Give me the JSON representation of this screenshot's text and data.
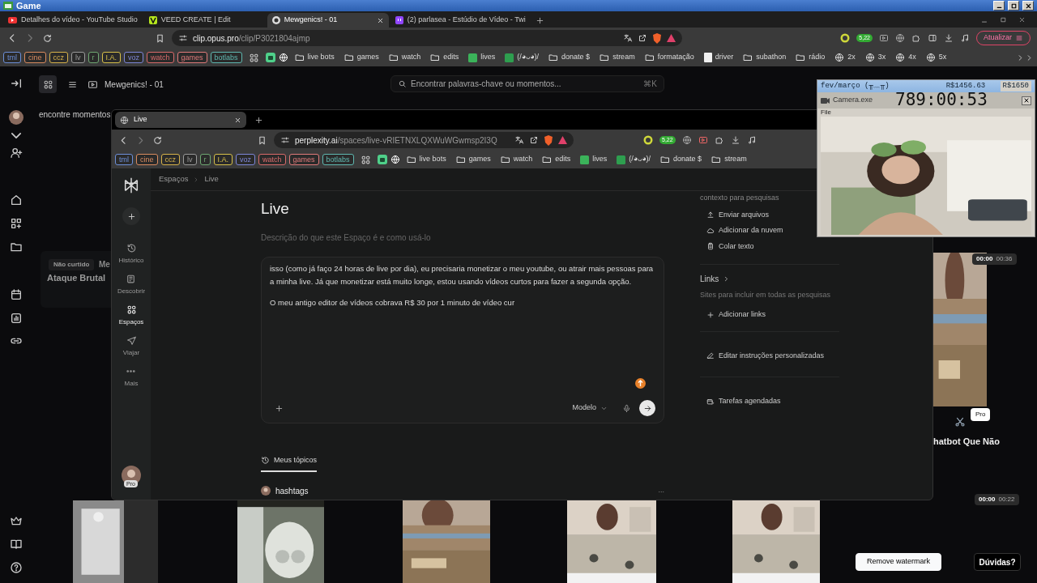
{
  "os_window": {
    "title": "Game"
  },
  "browser": {
    "tabs": [
      {
        "title": "Detalhes do vídeo - YouTube Studio",
        "selected": false
      },
      {
        "title": "VEED CREATE | Edit",
        "selected": false
      },
      {
        "title": "Mewgenics! - 01",
        "selected": true
      },
      {
        "title": "(2) parlasea - Estúdio de Vídeo - Twi",
        "selected": false
      }
    ],
    "address": {
      "domain": "clip.opus.pro",
      "path": "/clip/P3021804ajmp"
    },
    "extension_badge": "5,22",
    "update_button": "Atualizar",
    "bookmark_tags": [
      {
        "label": "tml",
        "color": "#6d8fd8"
      },
      {
        "label": "cine",
        "color": "#d98b5f"
      },
      {
        "label": "ccz",
        "color": "#d7b24a"
      },
      {
        "label": "lv",
        "color": "#9a9a9a"
      },
      {
        "label": "r",
        "color": "#6fa872"
      },
      {
        "label": "I.A.",
        "color": "#d7c04a"
      },
      {
        "label": "voz",
        "color": "#7d86d8"
      },
      {
        "label": "watch",
        "color": "#d86a6a"
      },
      {
        "label": "games",
        "color": "#e07a7a"
      },
      {
        "label": "botlabs",
        "color": "#5fb8b0"
      }
    ],
    "bookmarks": [
      {
        "label": "live bots",
        "kind": "folder"
      },
      {
        "label": "games",
        "kind": "folder"
      },
      {
        "label": "watch",
        "kind": "folder"
      },
      {
        "label": "edits",
        "kind": "folder"
      },
      {
        "label": "lives",
        "kind": "app"
      },
      {
        "label": "(/◕ᴗ◕)/",
        "kind": "app"
      },
      {
        "label": "donate $",
        "kind": "folder"
      },
      {
        "label": "stream",
        "kind": "folder"
      },
      {
        "label": "formatação",
        "kind": "folder"
      },
      {
        "label": "driver",
        "kind": "page"
      },
      {
        "label": "subathon",
        "kind": "folder"
      },
      {
        "label": "rádio",
        "kind": "folder"
      },
      {
        "label": "2x",
        "kind": "site"
      },
      {
        "label": "3x",
        "kind": "site"
      },
      {
        "label": "4x",
        "kind": "site"
      },
      {
        "label": "5x",
        "kind": "site"
      }
    ]
  },
  "editor": {
    "project_title": "Mewgenics! - 01",
    "search": {
      "placeholder": "Encontrar palavras-chave ou momentos...",
      "shortcut": "⌘K"
    },
    "hint": "encontre momentos",
    "clip_tag": "Não curtido",
    "clip_title_start": "Me",
    "clip_subtitle": "Ataque Brutal",
    "side_clip": {
      "time_current": "00:00",
      "time_total": "00:36",
      "badge": "Pro",
      "title": "hatbot Que Não"
    },
    "bottom_clip": {
      "time_current": "00:00",
      "time_total": "00:22"
    },
    "remove_watermark_button": "Remove watermark",
    "help_button": "Dúvidas?"
  },
  "inner_browser": {
    "tabs": [
      {
        "title": "Live",
        "selected": true
      }
    ],
    "address": {
      "domain": "perplexity.ai",
      "path": "/spaces/live-vRIETNXLQXWuWGwmsp2I3Q"
    },
    "extension_badge": "5,22",
    "bookmark_tags": [
      {
        "label": "tml",
        "color": "#6d8fd8"
      },
      {
        "label": "cine",
        "color": "#d98b5f"
      },
      {
        "label": "ccz",
        "color": "#d7b24a"
      },
      {
        "label": "lv",
        "color": "#9a9a9a"
      },
      {
        "label": "r",
        "color": "#6fa872"
      },
      {
        "label": "I.A.",
        "color": "#d7c04a"
      },
      {
        "label": "voz",
        "color": "#7d86d8"
      },
      {
        "label": "watch",
        "color": "#d86a6a"
      },
      {
        "label": "games",
        "color": "#e07a7a"
      },
      {
        "label": "botlabs",
        "color": "#5fb8b0"
      }
    ],
    "bookmarks": [
      {
        "label": "live bots",
        "kind": "folder"
      },
      {
        "label": "games",
        "kind": "folder"
      },
      {
        "label": "watch",
        "kind": "folder"
      },
      {
        "label": "edits",
        "kind": "folder"
      },
      {
        "label": "lives",
        "kind": "app"
      },
      {
        "label": "(/◕ᴗ◕)/",
        "kind": "app"
      },
      {
        "label": "donate $",
        "kind": "folder"
      },
      {
        "label": "stream",
        "kind": "folder"
      }
    ]
  },
  "perplexity": {
    "nav": [
      {
        "label": "Histórico",
        "selected": false
      },
      {
        "label": "Descobrir",
        "selected": false
      },
      {
        "label": "Espaços",
        "selected": true
      },
      {
        "label": "Viajar",
        "selected": false
      },
      {
        "label": "Mais",
        "selected": false
      }
    ],
    "avatar_badge": "Pro",
    "breadcrumb": [
      "Espaços",
      "Live"
    ],
    "title": "Live",
    "description_placeholder": "Descrição do que este Espaço é e como usá-lo",
    "instructions": [
      "isso (como já faço 24 horas de live por dia), eu precisaria monetizar o meu youtube, ou atrair mais pessoas para a minha live. Já que monetizar está muito longe, estou usando vídeos curtos para fazer a segunda opção.",
      "O meu antigo editor de vídeos cobrava R$ 30 por 1 minuto de vídeo cur"
    ],
    "model_button": "Modelo",
    "files_hint": "contexto para pesquisas",
    "file_actions": [
      "Enviar arquivos",
      "Adicionar da nuvem",
      "Colar texto"
    ],
    "links_title": "Links",
    "links_hint": "Sites para incluir em todas as pesquisas",
    "add_links": "Adicionar links",
    "edit_instructions": "Editar instruções personalizadas",
    "scheduled_tasks": "Tarefas agendadas",
    "tabs": [
      {
        "label": "Meus tópicos",
        "selected": true
      }
    ],
    "threads": [
      {
        "title": "hashtags",
        "menu": "..."
      }
    ]
  },
  "overlay": {
    "month": "fev/março (╥﹏╥)",
    "amount": "R$1456.63",
    "goal": "R$1650",
    "window_title": "Camera.exe",
    "timer": "789:00:53",
    "menu": "File"
  }
}
